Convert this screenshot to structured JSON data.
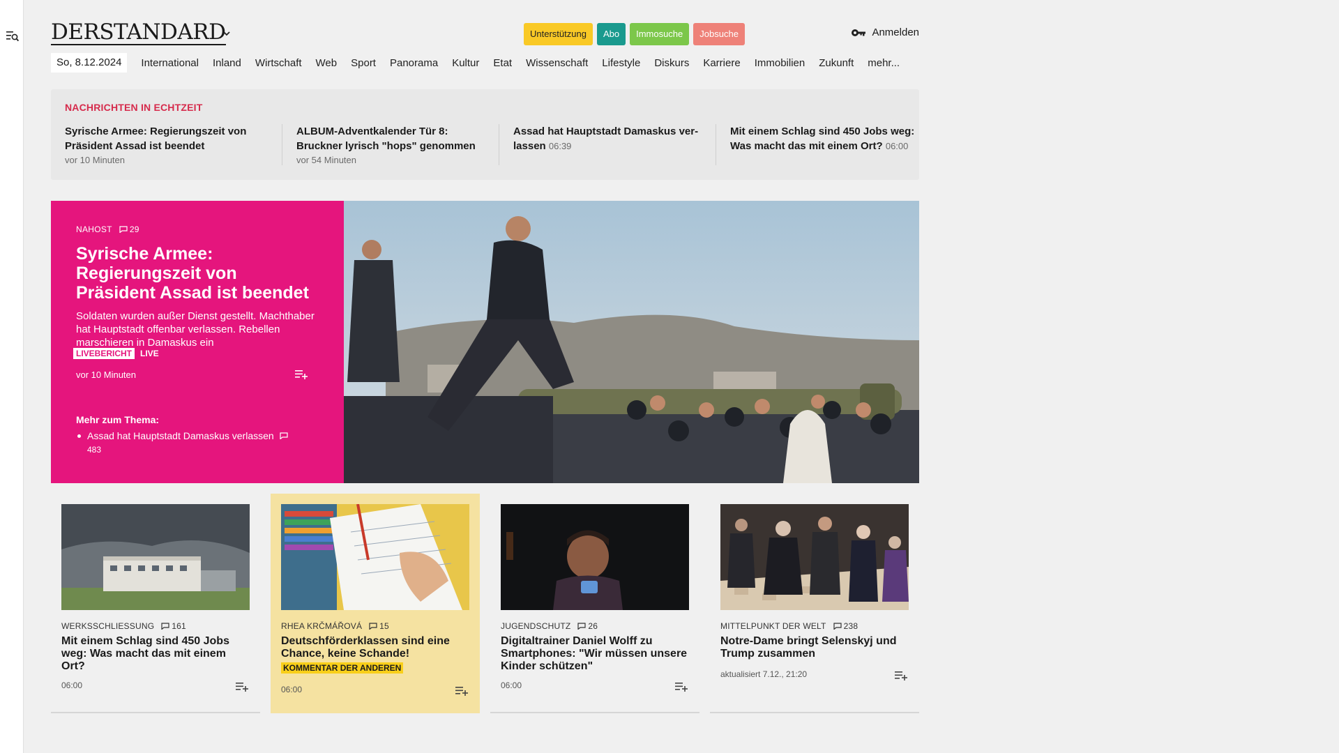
{
  "header": {
    "logo": "DERSTANDARD",
    "badges": [
      {
        "label": "Unterstützung",
        "bg": "#f9c926",
        "fg": "#222222"
      },
      {
        "label": "Abo",
        "bg": "#1a9a8e",
        "fg": "#ffffff"
      },
      {
        "label": "Immosuche",
        "bg": "#7cc74a",
        "fg": "#ffffff"
      },
      {
        "label": "Jobsuche",
        "bg": "#ee8178",
        "fg": "#ffffff"
      }
    ],
    "login_label": "Anmelden"
  },
  "nav": {
    "date": "So, 8.12.2024",
    "items": [
      "International",
      "Inland",
      "Wirtschaft",
      "Web",
      "Sport",
      "Panorama",
      "Kultur",
      "Etat",
      "Wissenschaft",
      "Lifestyle",
      "Diskurs",
      "Karriere",
      "Immobilien",
      "Zukunft",
      "mehr..."
    ]
  },
  "ticker": {
    "title": "NACHRICHTEN IN ECHTZEIT",
    "items": [
      {
        "headline": "Syrische Armee: Regierungszeit von Präsident Assad ist beendet",
        "time": "vor 10 Minuten"
      },
      {
        "headline": "ALBUM-Adventkalender Tür 8: Bruckner lyrisch \"hops\" genommen",
        "time": "vor 54 Minuten"
      },
      {
        "headline": "Assad hat Hauptstadt Damaskus ver-lassen",
        "time": "06:39"
      },
      {
        "headline": "Mit einem Schlag sind 450 Jobs weg: Was macht das mit einem Ort?",
        "time": "06:00"
      }
    ]
  },
  "hero": {
    "kicker": "NAHOST",
    "comments": "29",
    "title": "Syrische Armee: Regierungszeit von Präsident Assad ist beendet",
    "lead": "Soldaten wurden außer Dienst gestellt. Machthaber hat Hauptstadt offenbar verlassen. Rebellen marschieren in Damaskus ein",
    "live_tag": "LIVEBERICHT",
    "live_label": "LIVE",
    "time": "vor 10 Minuten",
    "more_title": "Mehr zum Thema:",
    "more_item": "Assad hat Hauptstadt Damaskus verlassen",
    "more_comments": "483",
    "accent": "#e5157d"
  },
  "cards": [
    {
      "kicker": "WERKSSCHLIESSUNG",
      "comments": "161",
      "title": "Mit einem Schlag sind 450 Jobs weg: Was macht das mit einem Ort?",
      "tag": "",
      "time": "06:00"
    },
    {
      "kicker": "RHEA KRČMÁŘOVÁ",
      "comments": "15",
      "title": "Deutschförderklassen sind eine Chance, keine Schande!",
      "tag": "KOMMENTAR DER ANDEREN",
      "time": "06:00"
    },
    {
      "kicker": "JUGENDSCHUTZ",
      "comments": "26",
      "title": "Digitaltrainer Daniel Wolff zu Smartphones: \"Wir müssen unsere Kinder schützen\"",
      "tag": "",
      "time": "06:00"
    },
    {
      "kicker": "MITTELPUNKT DER WELT",
      "comments": "238",
      "title": "Notre-Dame bringt Selenskyj und Trump zusammen",
      "tag": "",
      "time": "aktualisiert 7.12., 21:20"
    }
  ]
}
